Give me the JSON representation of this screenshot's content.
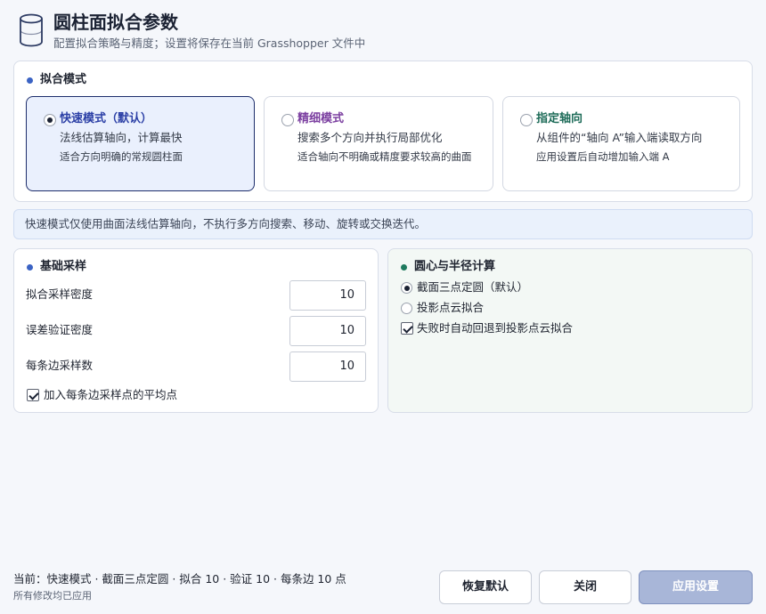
{
  "header": {
    "title": "圆柱面拟合参数",
    "subtitle": "配置拟合策略与精度；设置将保存在当前 Grasshopper 文件中",
    "icon": "cylinder-icon"
  },
  "fit_mode": {
    "title": "拟合模式",
    "accent": "#3b63c4",
    "options": [
      {
        "name": "快速模式（默认）",
        "line1": "法线估算轴向，计算最快",
        "line2": "适合方向明确的常规圆柱面",
        "selected": true,
        "color": "#2b3fa6"
      },
      {
        "name": "精细模式",
        "line1": "搜索多个方向并执行局部优化",
        "line2": "适合轴向不明确或精度要求较高的曲面",
        "selected": false,
        "color": "#7b3fa0"
      },
      {
        "name": "指定轴向",
        "line1": "从组件的“轴向 A”输入端读取方向",
        "line2": "应用设置后自动增加输入端 A",
        "selected": false,
        "color": "#1d6b58"
      }
    ]
  },
  "info_banner": "快速模式仅使用曲面法线估算轴向，不执行多方向搜索、移动、旋转或交换迭代。",
  "sampling": {
    "title": "基础采样",
    "accent": "#3b63c4",
    "fields": [
      {
        "label": "拟合采样密度",
        "value": "10"
      },
      {
        "label": "误差验证密度",
        "value": "10"
      },
      {
        "label": "每条边采样数",
        "value": "10"
      }
    ],
    "avg_point_label": "加入每条边采样点的平均点",
    "avg_point_checked": true
  },
  "center": {
    "title": "圆心与半径计算",
    "accent": "#1e7a5e",
    "options": [
      {
        "label": "截面三点定圆（默认）",
        "selected": true
      },
      {
        "label": "投影点云拟合",
        "selected": false
      }
    ],
    "fallback_label": "失败时自动回退到投影点云拟合",
    "fallback_checked": true
  },
  "footer": {
    "status": "当前：快速模式 · 截面三点定圆 · 拟合 10 · 验证 10 · 每条边 10 点",
    "sub": "所有修改均已应用",
    "reset_label": "恢复默认",
    "close_label": "关闭",
    "apply_label": "应用设置"
  }
}
